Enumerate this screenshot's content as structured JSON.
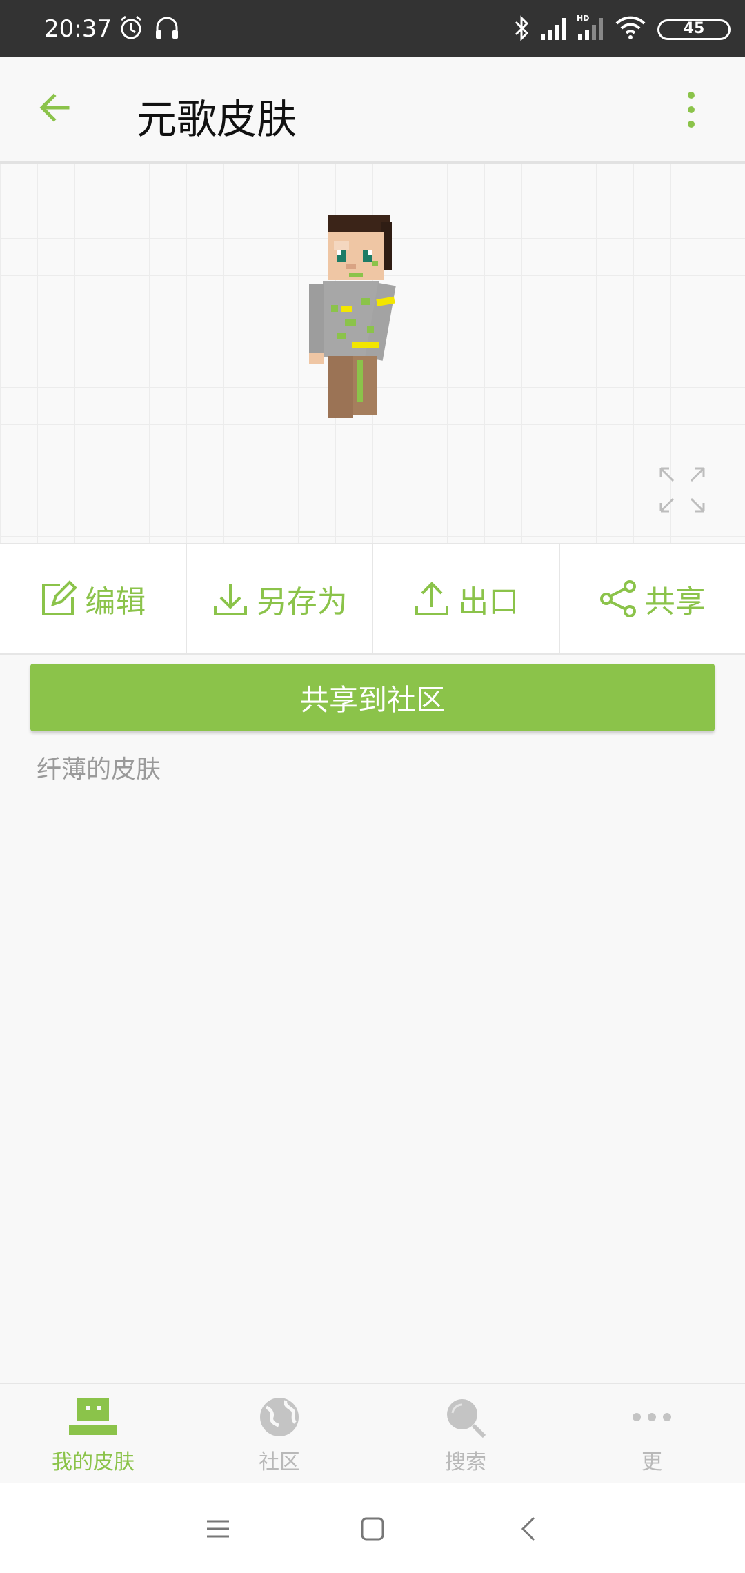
{
  "status_bar": {
    "time": "20:37",
    "battery": "45",
    "icons": [
      "alarm-icon",
      "headset-icon",
      "bluetooth-icon",
      "signal-icon",
      "hd-signal-icon",
      "wifi-icon",
      "battery-icon"
    ]
  },
  "app_bar": {
    "title": "元歌皮肤",
    "back_icon": "arrow-left-icon",
    "menu_icon": "more-vert-icon"
  },
  "preview": {
    "skin_description": "minecraft-skin-model",
    "fullscreen_icon": "expand-icon"
  },
  "actions": [
    {
      "label": "编辑",
      "icon": "edit-icon"
    },
    {
      "label": "另存为",
      "icon": "download-icon"
    },
    {
      "label": "出口",
      "icon": "upload-icon"
    },
    {
      "label": "共享",
      "icon": "share-icon"
    }
  ],
  "share_button": {
    "label": "共享到社区"
  },
  "description": "纤薄的皮肤",
  "bottom_nav": [
    {
      "label": "我的皮肤",
      "icon": "my-skin-icon",
      "active": true
    },
    {
      "label": "社区",
      "icon": "globe-icon",
      "active": false
    },
    {
      "label": "搜索",
      "icon": "search-icon",
      "active": false
    },
    {
      "label": "更",
      "icon": "more-horiz-icon",
      "active": false
    }
  ],
  "colors": {
    "accent": "#8bc34a",
    "status_bar": "#333333",
    "background": "#f8f8f8",
    "inactive": "#b9b9b9"
  }
}
